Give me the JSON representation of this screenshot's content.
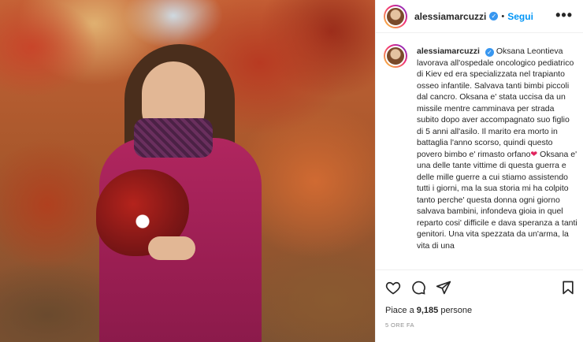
{
  "post": {
    "username": "alessiamarcuzzi",
    "verified_icon": "verified-badge-icon",
    "separator": "•",
    "follow_label": "Segui",
    "more_label": "•••",
    "caption_username": "alessiamarcuzzi",
    "caption_text": "Oksana Leontieva lavorava all'ospedale oncologico pediatrico di Kiev ed era specializzata nel trapianto osseo infantile. Salvava tanti bimbi piccoli dal cancro. Oksana e' stata uccisa da un missile mentre camminava per strada subito dopo aver accompagnato suo figlio di 5 anni all'asilo. Il marito era morto in battaglia l'anno scorso, quindi questo povero bimbo e' rimasto orfano",
    "caption_emoji": "❤",
    "caption_text_2": "Oksana e' una delle tante vittime di questa guerra e delle mille guerre a cui stiamo assistendo tutti i giorni, ma la sua storia mi ha colpito tanto perche' questa donna ogni giorno salvava bambini, infondeva gioia in quel reparto cosi' difficile e dava speranza a tanti genitori. Una vita spezzata da un'arma, la vita di una",
    "likes_prefix": "Piace a ",
    "likes_count": "9,185",
    "likes_suffix": " persone",
    "timestamp": "5 ORE FA"
  },
  "colors": {
    "accent": "#0095f6",
    "verified": "#3897f0",
    "text": "#262626",
    "muted": "#8e8e8e"
  },
  "icons": [
    "heart-icon",
    "comment-icon",
    "share-icon",
    "bookmark-icon",
    "more-options-icon"
  ]
}
